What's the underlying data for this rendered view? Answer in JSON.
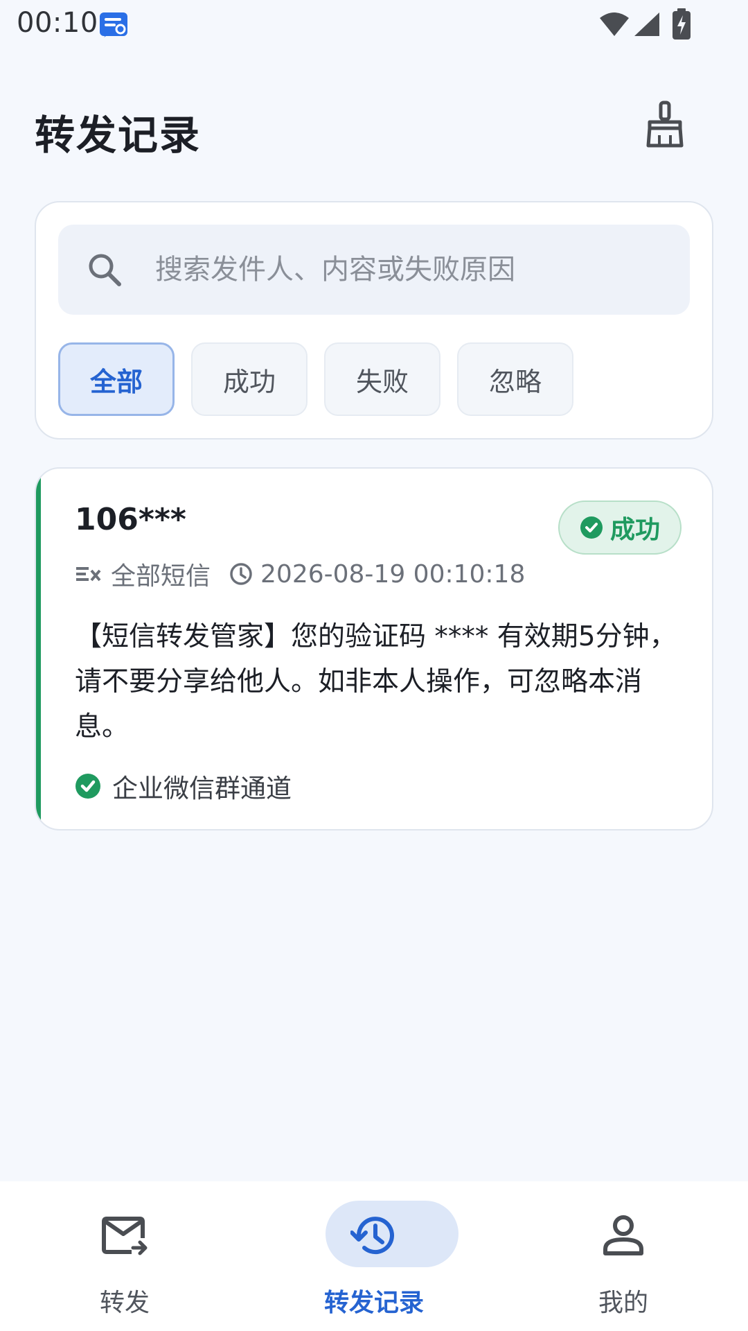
{
  "status_bar": {
    "time": "00:10",
    "app_icon": "message-app-icon",
    "icons": [
      "wifi-icon",
      "cell-signal-icon",
      "battery-charging-icon"
    ]
  },
  "header": {
    "title": "转发记录",
    "action_icon": "broom-clean-icon"
  },
  "search": {
    "placeholder": "搜索发件人、内容或失败原因",
    "value": ""
  },
  "filters": [
    {
      "label": "全部",
      "active": true
    },
    {
      "label": "成功",
      "active": false
    },
    {
      "label": "失败",
      "active": false
    },
    {
      "label": "忽略",
      "active": false
    }
  ],
  "records": [
    {
      "sender": "106***",
      "status": "成功",
      "rule": "全部短信",
      "timestamp": "2026-08-19 00:10:18",
      "content": "【短信转发管家】您的验证码 **** 有效期5分钟，请不要分享给他人。如非本人操作，可忽略本消息。",
      "channel": "企业微信群通道"
    }
  ],
  "bottom_nav": [
    {
      "label": "转发",
      "icon": "mail-forward-icon",
      "active": false
    },
    {
      "label": "转发记录",
      "icon": "history-icon",
      "active": true
    },
    {
      "label": "我的",
      "icon": "person-icon",
      "active": false
    }
  ],
  "colors": {
    "accent": "#2563d1",
    "success": "#1f9a5f",
    "background": "#f5f8fd"
  }
}
